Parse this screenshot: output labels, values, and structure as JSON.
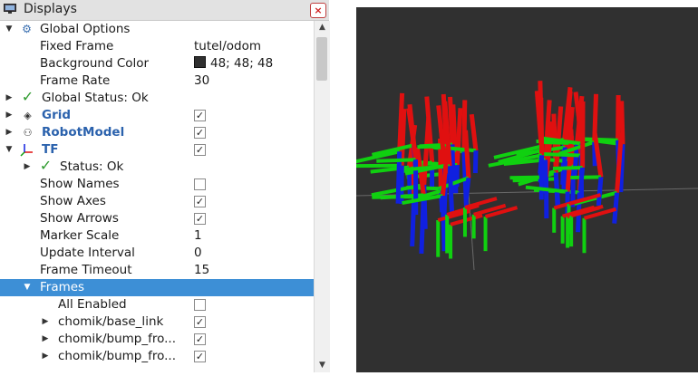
{
  "panel": {
    "title": "Displays",
    "close_label": "×"
  },
  "tree": {
    "global_options": {
      "label": "Global Options",
      "fixed_frame": {
        "label": "Fixed Frame",
        "value": "tutel/odom"
      },
      "background_color": {
        "label": "Background Color",
        "value": "48; 48; 48",
        "swatch": "#303030"
      },
      "frame_rate": {
        "label": "Frame Rate",
        "value": "30"
      }
    },
    "global_status": {
      "label": "Global Status: Ok"
    },
    "grid": {
      "label": "Grid",
      "checked": true
    },
    "robot_model": {
      "label": "RobotModel",
      "checked": true
    },
    "tf": {
      "label": "TF",
      "checked": true,
      "status": {
        "label": "Status: Ok"
      },
      "show_names": {
        "label": "Show Names",
        "checked": false
      },
      "show_axes": {
        "label": "Show Axes",
        "checked": true
      },
      "show_arrows": {
        "label": "Show Arrows",
        "checked": true
      },
      "marker_scale": {
        "label": "Marker Scale",
        "value": "1"
      },
      "update_interval": {
        "label": "Update Interval",
        "value": "0"
      },
      "frame_timeout": {
        "label": "Frame Timeout",
        "value": "15"
      },
      "frames": {
        "label": "Frames",
        "all_enabled": {
          "label": "All Enabled",
          "checked": false
        },
        "items": [
          {
            "label": "chomik/base_link",
            "checked": true
          },
          {
            "label": "chomik/bump_fro...",
            "checked": true
          },
          {
            "label": "chomik/bump_fro...",
            "checked": true
          }
        ]
      }
    }
  },
  "viewport": {
    "background": "#303030"
  },
  "colors": {
    "selection": "#3d8fd6",
    "link_blue": "#2b62ad",
    "status_green": "#2d9a2d",
    "axis_x": "#e01010",
    "axis_y": "#10d010",
    "axis_z": "#1020e0"
  }
}
